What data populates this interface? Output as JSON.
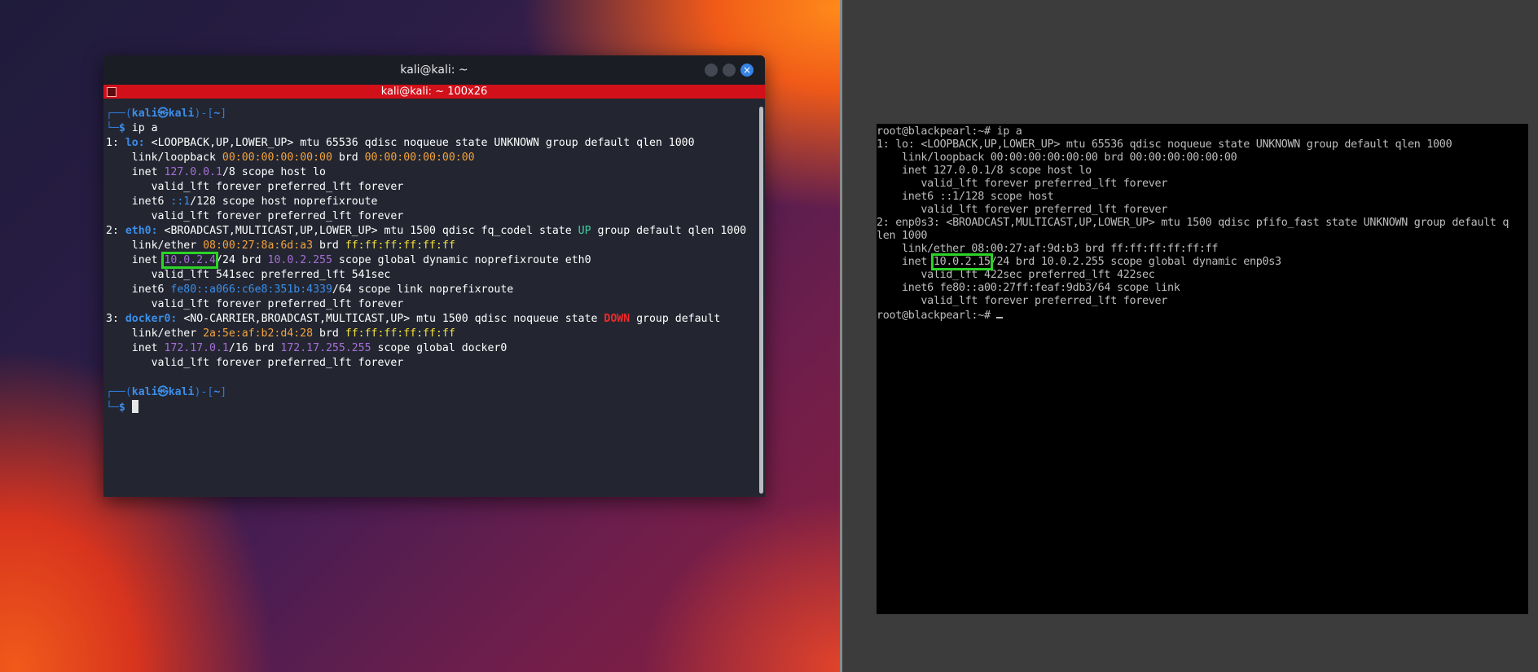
{
  "kali": {
    "window_title": "kali@kali: ~",
    "tab_title": "kali@kali: ~ 100x26",
    "close_glyph": "×",
    "prompt_user": "kali",
    "prompt_at": "㉿",
    "prompt_host": "kali",
    "prompt_dir": "~",
    "command": "ip a",
    "lo": {
      "num": "1:",
      "name": "lo:",
      "flags": "<LOOPBACK,UP,LOWER_UP> mtu 65536 qdisc noqueue state UNKNOWN group default qlen 1000",
      "link": "00:00:00:00:00:00",
      "brd": "00:00:00:00:00:00",
      "inet": "127.0.0.1",
      "inet_rest": "/8 scope host lo",
      "valid1": "valid_lft forever preferred_lft forever",
      "inet6": "::1",
      "inet6_rest": "/128 scope host noprefixroute",
      "valid2": "valid_lft forever preferred_lft forever"
    },
    "eth0": {
      "num": "2:",
      "name": "eth0:",
      "flags_a": "<BROADCAST,MULTICAST,UP,LOWER_UP> mtu 1500 qdisc fq_codel state ",
      "state": "UP",
      "flags_b": " group default qlen 1000",
      "link": "08:00:27:8a:6d:a3",
      "brd": "ff:ff:ff:ff:ff:ff",
      "inet": "10.0.2.4",
      "inet_mask": "/24 brd ",
      "inet_brd": "10.0.2.255",
      "inet_rest": " scope global dynamic noprefixroute eth0",
      "valid1": "valid_lft 541sec preferred_lft 541sec",
      "inet6": "fe80::a066:c6e8:351b:4339",
      "inet6_rest": "/64 scope link noprefixroute",
      "valid2": "valid_lft forever preferred_lft forever"
    },
    "docker0": {
      "num": "3:",
      "name": "docker0:",
      "flags_a": "<NO-CARRIER,BROADCAST,MULTICAST,UP> mtu 1500 qdisc noqueue state ",
      "state": "DOWN",
      "flags_b": " group default",
      "link": "2a:5e:af:b2:d4:28",
      "brd": "ff:ff:ff:ff:ff:ff",
      "inet": "172.17.0.1",
      "inet_mask": "/16 brd ",
      "inet_brd": "172.17.255.255",
      "inet_rest": " scope global docker0",
      "valid1": "valid_lft forever preferred_lft forever"
    }
  },
  "blackpearl": {
    "lines": [
      "root@blackpearl:~# ip a",
      "1: lo: <LOOPBACK,UP,LOWER_UP> mtu 65536 qdisc noqueue state UNKNOWN group default qlen 1000",
      "    link/loopback 00:00:00:00:00:00 brd 00:00:00:00:00:00",
      "    inet 127.0.0.1/8 scope host lo",
      "       valid_lft forever preferred_lft forever",
      "    inet6 ::1/128 scope host",
      "       valid_lft forever preferred_lft forever",
      "2: enp0s3: <BROADCAST,MULTICAST,UP,LOWER_UP> mtu 1500 qdisc pfifo_fast state UNKNOWN group default q",
      "len 1000",
      "    link/ether 08:00:27:af:9d:b3 brd ff:ff:ff:ff:ff:ff"
    ],
    "inet_prefix": "    inet ",
    "inet_ip": "10.0.2.15",
    "inet_rest": "/24 brd 10.0.2.255 scope global dynamic enp0s3",
    "lines_after": [
      "       valid_lft 422sec preferred_lft 422sec",
      "    inet6 fe80::a00:27ff:feaf:9db3/64 scope link",
      "       valid_lft forever preferred_lft forever"
    ],
    "final_prompt": "root@blackpearl:~# "
  },
  "colors": {
    "kali_titlebar": "#1b1d24",
    "kali_tabbar": "#d2101a",
    "kali_bg": "#232631",
    "highlight": "#2dd228",
    "bp_bg": "#000000"
  }
}
